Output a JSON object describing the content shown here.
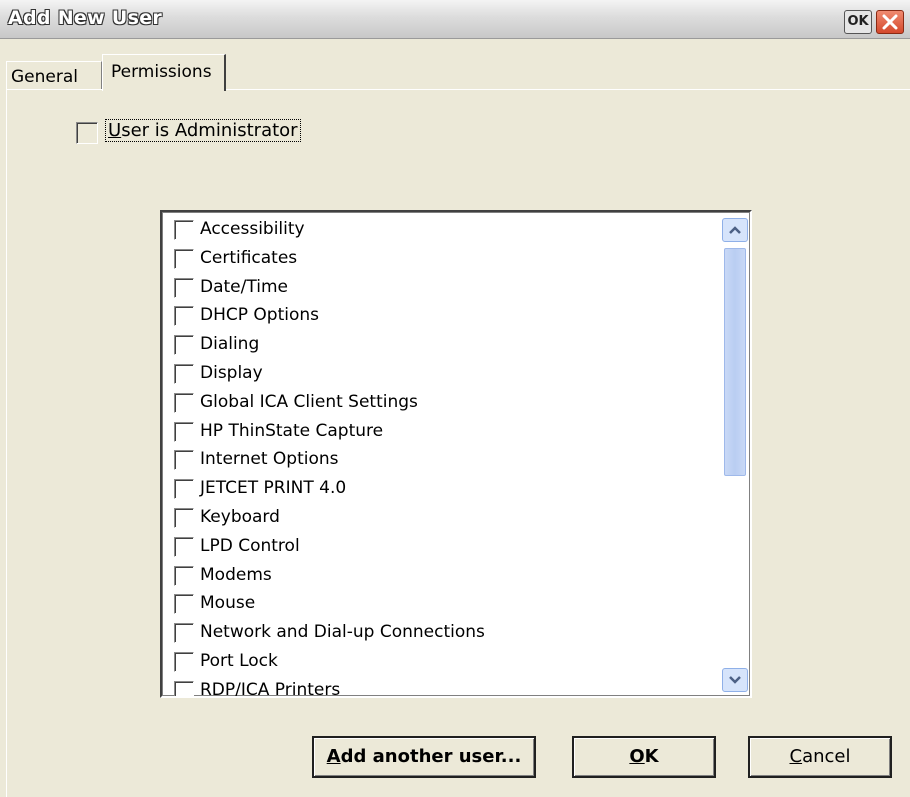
{
  "window": {
    "title": "Add New User",
    "titlebar_ok_label": "OK"
  },
  "tabs": [
    {
      "label": "General",
      "selected": false
    },
    {
      "label": "Permissions",
      "selected": true
    }
  ],
  "admin": {
    "label_mnemonic": "U",
    "label_rest": "ser is Administrator",
    "checked": false
  },
  "permissions": [
    "Accessibility",
    "Certificates",
    "Date/Time",
    "DHCP Options",
    "Dialing",
    "Display",
    "Global ICA Client Settings",
    "HP ThinState Capture",
    "Internet Options",
    "JETCET PRINT 4.0",
    "Keyboard",
    "LPD Control",
    "Modems",
    "Mouse",
    "Network and Dial-up Connections",
    "Port Lock",
    "RDP/ICA Printers"
  ],
  "buttons": {
    "add_mnemonic": "A",
    "add_rest": "dd another user...",
    "ok_mnemonic": "O",
    "ok_rest": "K",
    "cancel_mnemonic": "C",
    "cancel_rest": "ancel"
  },
  "icons": {
    "close": "close-icon",
    "scroll_up": "chevron-up-icon",
    "scroll_down": "chevron-down-icon"
  },
  "colors": {
    "face": "#ece9d8",
    "close": "#d4482c",
    "scroll": "#c9d9f6"
  }
}
